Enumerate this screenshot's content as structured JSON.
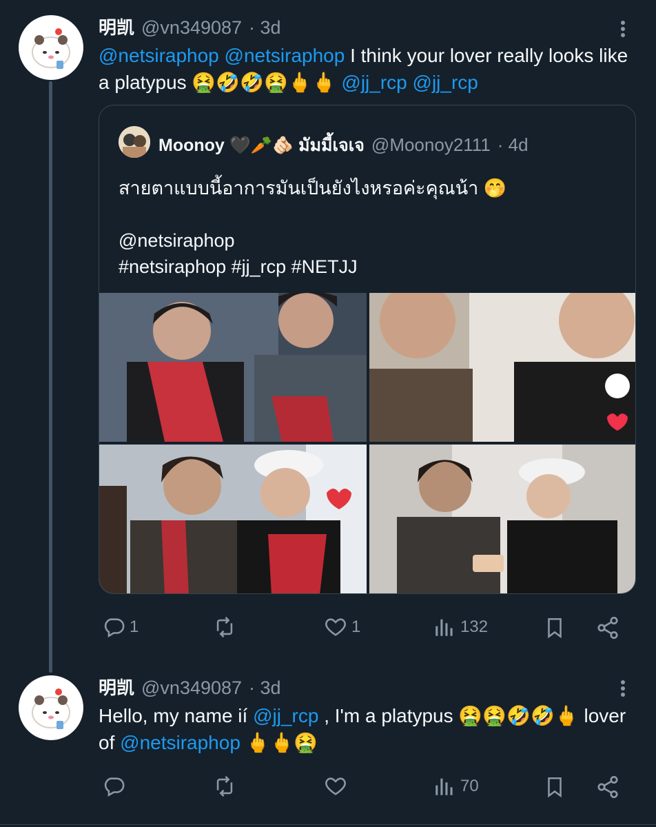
{
  "tweet1": {
    "name": "明凯",
    "handle": "@vn349087",
    "time": "· 3d",
    "text_parts": [
      {
        "t": "@netsiraphop",
        "mention": true
      },
      {
        "t": " ",
        "mention": false
      },
      {
        "t": "@netsiraphop",
        "mention": true
      },
      {
        "t": " I think your lover really looks like a platypus 🤮🤣🤣🤮🖕🖕 ",
        "mention": false
      },
      {
        "t": "@jj_rcp",
        "mention": true
      },
      {
        "t": " ",
        "mention": false
      },
      {
        "t": "@jj_rcp",
        "mention": true
      }
    ],
    "stats": {
      "replies": "1",
      "retweets": "",
      "likes": "1",
      "views": "132"
    }
  },
  "quote": {
    "name": "Moonoy 🖤🥕🫵🏻 มัมมี้เจเจ",
    "handle": "@Moonoy2111",
    "time": "· 4d",
    "line1": "สายตาแบบนี้อาการมันเป็นยังไงหรอค่ะคุณน้า 🤭",
    "line2": "@netsiraphop",
    "line3": "#netsiraphop  #jj_rcp #NETJJ"
  },
  "tweet2": {
    "name": "明凯",
    "handle": "@vn349087",
    "time": "· 3d",
    "text_parts": [
      {
        "t": "Hello, my name ií ",
        "mention": false
      },
      {
        "t": "@jj_rcp",
        "mention": true
      },
      {
        "t": " , I'm a platypus 🤮🤮🤣🤣🖕 lover of ",
        "mention": false
      },
      {
        "t": "@netsiraphop",
        "mention": true
      },
      {
        "t": " 🖕🖕🤮",
        "mention": false
      }
    ],
    "stats": {
      "replies": "",
      "retweets": "",
      "likes": "",
      "views": "70"
    }
  },
  "colors": {
    "background": "#15202b",
    "mention": "#1d9bf0",
    "muted": "#8b98a5"
  },
  "icons": [
    "more-icon",
    "reply-icon",
    "retweet-icon",
    "like-icon",
    "views-icon",
    "bookmark-icon",
    "share-icon"
  ]
}
